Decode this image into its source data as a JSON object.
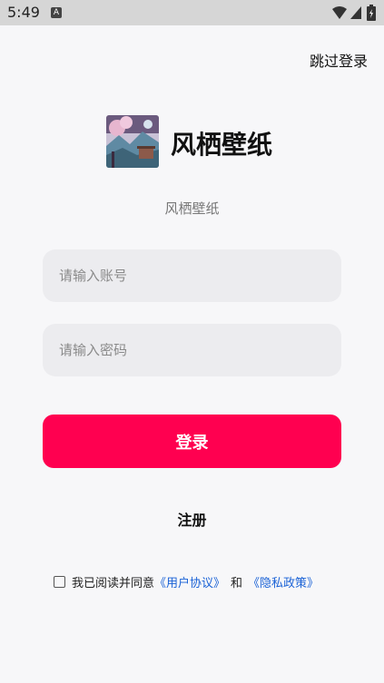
{
  "status": {
    "time": "5:49",
    "notif_glyph": "A",
    "icons": [
      "notification-icon",
      "wifi-icon",
      "signal-icon",
      "battery-icon"
    ]
  },
  "header": {
    "skip_login": "跳过登录"
  },
  "brand": {
    "app_name": "风栖壁纸",
    "subtitle": "风栖壁纸"
  },
  "form": {
    "account_placeholder": "请输入账号",
    "password_placeholder": "请输入密码",
    "login_label": "登录",
    "register_label": "注册"
  },
  "agreement": {
    "prefix": "我已阅读并同意",
    "user_agreement": "《用户协议》",
    "and": "和",
    "privacy_policy": "《隐私政策》",
    "checked": false
  },
  "colors": {
    "accent": "#ff0050",
    "link": "#1a62d6",
    "input_bg": "#ececef",
    "page_bg": "#f7f7f9"
  }
}
